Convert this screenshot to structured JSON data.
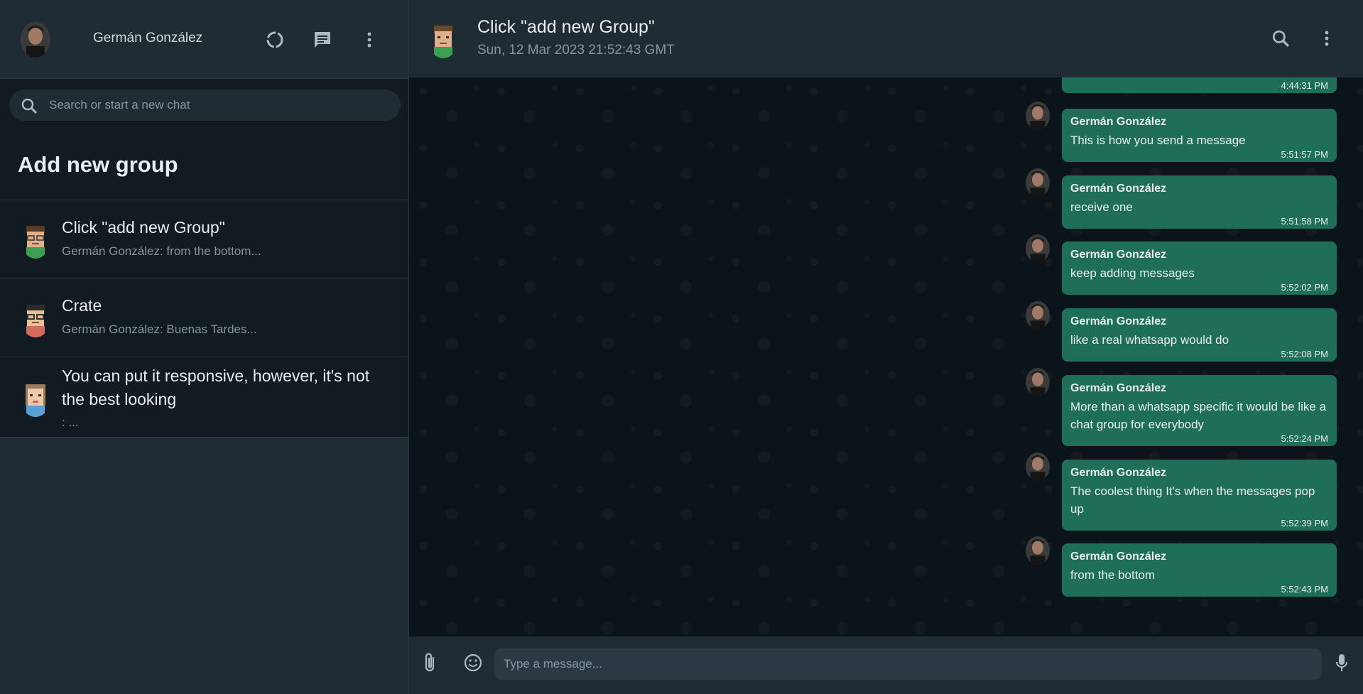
{
  "sidebar": {
    "user": {
      "name": "Germán González"
    },
    "icons": [
      "status-icon",
      "new-chat-icon",
      "menu-icon"
    ],
    "search": {
      "placeholder": "Search or start a new chat"
    },
    "add_group_label": "Add new group",
    "chats": [
      {
        "title": "Click \"add new Group\"",
        "preview": "Germán González: from the bottom..."
      },
      {
        "title": "Crate",
        "preview": "Germán González: Buenas Tardes..."
      },
      {
        "title": "You can put it responsive, however, it's not the best looking",
        "preview": ": ..."
      }
    ]
  },
  "conversation": {
    "title": "Click \"add new Group\"",
    "subtitle": "Sun, 12 Mar 2023 21:52:43 GMT",
    "icons": [
      "search-icon",
      "menu-icon"
    ],
    "messages": [
      {
        "sender": "",
        "text": "",
        "time": "4:44:31 PM"
      },
      {
        "sender": "Germán González",
        "text": "This is how you send a message",
        "time": "5:51:57 PM"
      },
      {
        "sender": "Germán González",
        "text": "receive one",
        "time": "5:51:58 PM"
      },
      {
        "sender": "Germán González",
        "text": "keep adding messages",
        "time": "5:52:02 PM"
      },
      {
        "sender": "Germán González",
        "text": "like a real whatsapp would do",
        "time": "5:52:08 PM"
      },
      {
        "sender": "Germán González",
        "text": "More than a whatsapp specific it would be like a chat group for everybody",
        "time": "5:52:24 PM"
      },
      {
        "sender": "Germán González",
        "text": "The coolest thing It's when the messages pop up",
        "time": "5:52:39 PM"
      },
      {
        "sender": "Germán González",
        "text": "from the bottom",
        "time": "5:52:43 PM"
      }
    ],
    "composer": {
      "placeholder": "Type a message..."
    }
  },
  "colors": {
    "panel": "#202c33",
    "background": "#111b21",
    "bubble": "#1f6e57",
    "muted_text": "#8696a0"
  }
}
